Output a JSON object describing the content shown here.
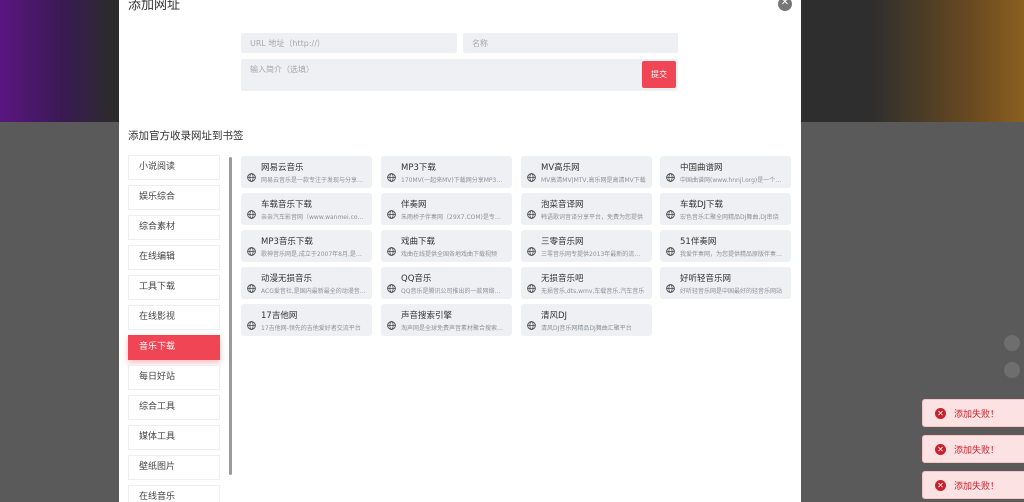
{
  "modal": {
    "title": "添加网址",
    "close_icon": "close-icon"
  },
  "form": {
    "url_placeholder": "URL 地址（http://）",
    "name_placeholder": "名称",
    "desc_placeholder": "输入简介（选填）",
    "submit_label": "提交"
  },
  "section_title": "添加官方收录网址到书签",
  "categories": [
    {
      "label": "小说阅读"
    },
    {
      "label": "娱乐综合"
    },
    {
      "label": "综合素材"
    },
    {
      "label": "在线编辑"
    },
    {
      "label": "工具下载"
    },
    {
      "label": "在线影视"
    },
    {
      "label": "音乐下载",
      "active": true
    },
    {
      "label": "每日好站"
    },
    {
      "label": "综合工具"
    },
    {
      "label": "媒体工具"
    },
    {
      "label": "壁纸图片"
    },
    {
      "label": "在线音乐"
    }
  ],
  "sites": [
    {
      "name": "网易云音乐",
      "desc": "网易云音乐是一款专注于发现与分享的音乐产品"
    },
    {
      "name": "MP3下载",
      "desc": "170MV(一起来MV)下载网分享MP3歌曲"
    },
    {
      "name": "MV高乐网",
      "desc": "MV高清MV|MTV,高乐网是高清MV下载"
    },
    {
      "name": "中国曲谱网",
      "desc": "中国曲谱网(www.hnnjl.org)是一个曲谱分享网站"
    },
    {
      "name": "车载音乐下载",
      "desc": "亲亲汽车影音网（www.wanmei.com）"
    },
    {
      "name": "伴奏网",
      "desc": "朱雨桥子伴奏网（29X7.COM)是专业伴奏"
    },
    {
      "name": "泡菜音译网",
      "desc": "韩语歌词音译分享平台，免费为您提供"
    },
    {
      "name": "车载DJ下载",
      "desc": "宏色音乐汇聚全网精品DJ舞曲,DJ串烧"
    },
    {
      "name": "MP3音乐下载",
      "desc": "歌神音乐网是,成立于2007年8月,是国内"
    },
    {
      "name": "戏曲下载",
      "desc": "戏曲在线提供全国各地戏曲下载视频"
    },
    {
      "name": "三零音乐网",
      "desc": "三零音乐网专提供2013年最新的流行歌曲"
    },
    {
      "name": "51伴奏网",
      "desc": "我爱伴奏网，为您提供精品原版伴奏MP3"
    },
    {
      "name": "动漫无损音乐",
      "desc": "ACG爱音社,是国内最新最全的动漫音乐网"
    },
    {
      "name": "QQ音乐",
      "desc": "QQ音乐是腾讯公司推出的一款网络音乐服务产品"
    },
    {
      "name": "无损音乐吧",
      "desc": "无损音乐,dts,wmv,车载音乐,汽车音乐"
    },
    {
      "name": "好听轻音乐网",
      "desc": "好听轻音乐网是中国最好的轻音乐网站"
    },
    {
      "name": "17吉他网",
      "desc": "17吉他网-领先的吉他爱好者交流平台"
    },
    {
      "name": "声音搜索引擎",
      "desc": "淘声网是全球免费声音素材聚合搜索引擎"
    },
    {
      "name": "清风DJ",
      "desc": "清风DJ音乐网精品DJ舞曲汇聚平台"
    }
  ],
  "toasts": [
    {
      "text": "添加失败！",
      "icon": "error-x-icon"
    },
    {
      "text": "添加失败！",
      "icon": "error-x-icon"
    },
    {
      "text": "添加失败！",
      "icon": "error-x-icon"
    }
  ],
  "site_icon": "globe-icon"
}
